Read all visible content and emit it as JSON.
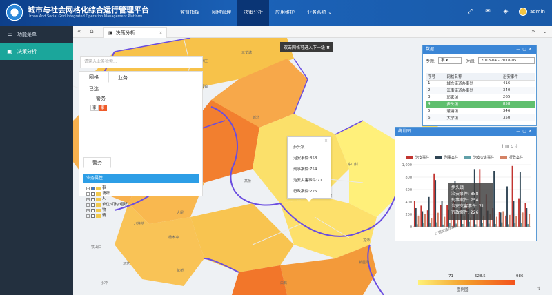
{
  "header": {
    "title": "城市与社会网格化综合运行管理平台",
    "subtitle": "Urban And Social Grid Integrated Operation Management Platform",
    "nav": [
      {
        "label": "监督指挥",
        "active": false
      },
      {
        "label": "网格管理",
        "active": false
      },
      {
        "label": "决策分析",
        "active": true
      },
      {
        "label": "应用维护",
        "active": false
      },
      {
        "label": "业务系统 ⌄",
        "active": false
      }
    ],
    "user": "admin"
  },
  "sidebar": {
    "items": [
      {
        "label": "功能菜单",
        "icon": "menu-icon",
        "active": false
      },
      {
        "label": "决策分析",
        "icon": "monitor-icon",
        "active": true
      }
    ]
  },
  "tabbar": {
    "tab_label": "决策分析"
  },
  "map": {
    "notice": "双击网格可进入下一级",
    "search_placeholder": "请输入业务检索...",
    "places": [
      {
        "t": "谷溪镇",
        "x": 180,
        "y": 67
      },
      {
        "t": "三丈塘",
        "x": 244,
        "y": 18
      },
      {
        "t": "龙厚庄",
        "x": 180,
        "y": 30
      },
      {
        "t": "杨家坪",
        "x": 60,
        "y": 68
      },
      {
        "t": "九山寨",
        "x": 28,
        "y": 36
      },
      {
        "t": "城北",
        "x": 260,
        "y": 112
      },
      {
        "t": "石门乡",
        "x": 326,
        "y": 150
      },
      {
        "t": "东山村",
        "x": 398,
        "y": 180
      },
      {
        "t": "八块地",
        "x": 88,
        "y": 266
      },
      {
        "t": "大屋",
        "x": 150,
        "y": 250
      },
      {
        "t": "杨木冲",
        "x": 138,
        "y": 286
      },
      {
        "t": "马龙",
        "x": 72,
        "y": 324
      },
      {
        "t": "花桥",
        "x": 150,
        "y": 334
      },
      {
        "t": "铁山口",
        "x": 26,
        "y": 300
      },
      {
        "t": "小冲",
        "x": 40,
        "y": 352
      },
      {
        "t": "胜利村",
        "x": 360,
        "y": 226
      },
      {
        "t": "龙潭",
        "x": 420,
        "y": 290
      },
      {
        "t": "白石",
        "x": 300,
        "y": 352
      },
      {
        "t": "高桥",
        "x": 248,
        "y": 204
      },
      {
        "t": "新屋场",
        "x": 414,
        "y": 322
      }
    ]
  },
  "filter": {
    "tabs": [
      "网格",
      "业务"
    ],
    "selected_label": "已选",
    "group_label": "警务",
    "chips": [
      {
        "label": "事",
        "on": false
      },
      {
        "label": "事",
        "on": true
      }
    ],
    "subtab": "警务",
    "attr_header": "业务属性",
    "tree": [
      {
        "label": "事",
        "checked": true
      },
      {
        "label": "场所",
        "checked": false
      },
      {
        "label": "人",
        "checked": false
      },
      {
        "label": "单位/机构/组织",
        "checked": false
      },
      {
        "label": "物",
        "checked": false
      },
      {
        "label": "情",
        "checked": false
      }
    ]
  },
  "popup": {
    "title": "步头镇",
    "lines": [
      "治安事件:858",
      "刑事案件:754",
      "治安灾害事件:71",
      "行政案件:226"
    ]
  },
  "data_window": {
    "title": "数据",
    "type_label": "专题:",
    "type_value": "事",
    "time_label": "时间:",
    "time_value": "2018-04 - 2018-05",
    "columns": [
      "序号",
      "网格名称",
      "治安事件"
    ],
    "rows": [
      [
        "1",
        "城东街道办事处",
        "416"
      ],
      [
        "2",
        "江南街道办事处",
        "340"
      ],
      [
        "3",
        "邓家铺",
        "265"
      ],
      [
        "4",
        "步头镇",
        "858"
      ],
      [
        "5",
        "蓬塘镇",
        "346"
      ],
      [
        "6",
        "大宁镇",
        "350"
      ]
    ],
    "selected_row": 3
  },
  "chart_window": {
    "title": "统计图",
    "tooltip": {
      "title": "步头镇",
      "lines": [
        "治安事件: 858",
        "刑事案件: 754",
        "治安灾害事件: 71",
        "行政案件: 226"
      ]
    }
  },
  "chart_data": {
    "type": "bar",
    "series": [
      {
        "name": "治安事件",
        "color": "#c23531",
        "values": [
          416,
          340,
          265,
          858,
          346,
          350,
          420,
          610,
          380,
          290,
          930,
          520,
          300,
          240,
          180,
          980,
          460,
          380
        ]
      },
      {
        "name": "刑事案件",
        "color": "#2f4554",
        "values": [
          300,
          250,
          480,
          754,
          420,
          280,
          740,
          360,
          290,
          930,
          310,
          260,
          900,
          230,
          650,
          420,
          880,
          300
        ]
      },
      {
        "name": "治安灾害事件",
        "color": "#61a0a8",
        "values": [
          40,
          55,
          60,
          71,
          35,
          60,
          50,
          45,
          80,
          40,
          65,
          50,
          45,
          70,
          40,
          55,
          60,
          45
        ]
      },
      {
        "name": "行政案件",
        "color": "#d48265",
        "values": [
          180,
          200,
          140,
          226,
          160,
          190,
          210,
          170,
          150,
          230,
          180,
          200,
          160,
          250,
          190,
          170,
          230,
          210
        ]
      }
    ],
    "ylim": [
      0,
      1000
    ],
    "yticks": [
      "0",
      "200",
      "400",
      "600",
      "800",
      "1,000"
    ],
    "x_label_visible": "江南街道办事处",
    "legend_position": "top",
    "grid": true
  },
  "scale": {
    "min": "71",
    "mid": "528.5",
    "max": "986",
    "bottom_label": "图例图"
  }
}
